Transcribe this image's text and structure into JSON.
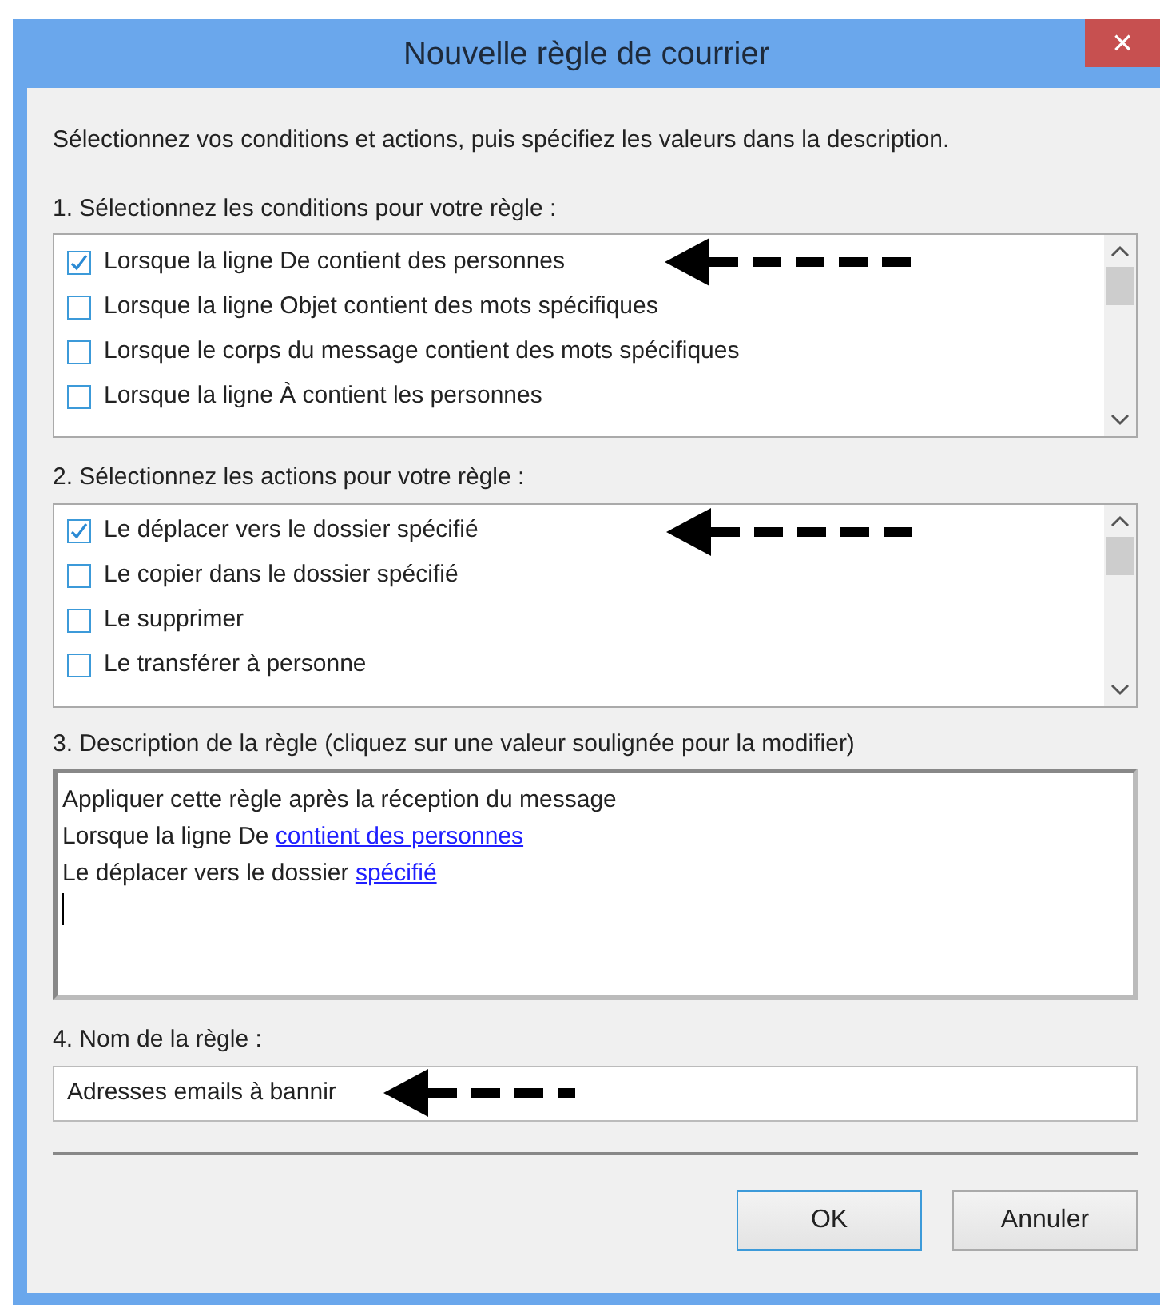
{
  "window": {
    "title": "Nouvelle règle de courrier",
    "close": "×"
  },
  "instructions": "Sélectionnez vos conditions et actions, puis spécifiez les valeurs dans la description.",
  "conditions": {
    "label": "1. Sélectionnez les conditions pour votre règle :",
    "items": [
      {
        "label": "Lorsque la ligne De contient des personnes",
        "checked": true,
        "arrow": true
      },
      {
        "label": "Lorsque la ligne Objet contient des mots spécifiques",
        "checked": false,
        "arrow": false
      },
      {
        "label": "Lorsque le corps du message contient des mots spécifiques",
        "checked": false,
        "arrow": false
      },
      {
        "label": "Lorsque la ligne À contient les personnes",
        "checked": false,
        "arrow": false
      }
    ]
  },
  "actions": {
    "label": "2. Sélectionnez les actions pour votre règle :",
    "items": [
      {
        "label": "Le déplacer vers le dossier spécifié",
        "checked": true,
        "arrow": true
      },
      {
        "label": "Le copier dans le dossier spécifié",
        "checked": false,
        "arrow": false
      },
      {
        "label": "Le supprimer",
        "checked": false,
        "arrow": false
      },
      {
        "label": "Le transférer à personne",
        "checked": false,
        "arrow": false
      }
    ]
  },
  "description": {
    "label": "3. Description de la règle (cliquez sur une valeur soulignée pour la modifier)",
    "lines": [
      {
        "segments": [
          {
            "kind": "text",
            "text": "Appliquer cette règle après la réception du message"
          }
        ]
      },
      {
        "segments": [
          {
            "kind": "text",
            "text": "Lorsque la ligne De "
          },
          {
            "kind": "link",
            "text": "contient des personnes"
          }
        ]
      },
      {
        "segments": [
          {
            "kind": "text",
            "text": "Le déplacer vers le dossier "
          },
          {
            "kind": "link",
            "text": "spécifié"
          }
        ]
      }
    ]
  },
  "rule_name": {
    "label": "4. Nom de la règle :",
    "value": "Adresses emails à bannir"
  },
  "buttons": [
    {
      "label": "OK",
      "kind": "default"
    },
    {
      "label": "Annuler",
      "kind": "normal"
    }
  ]
}
